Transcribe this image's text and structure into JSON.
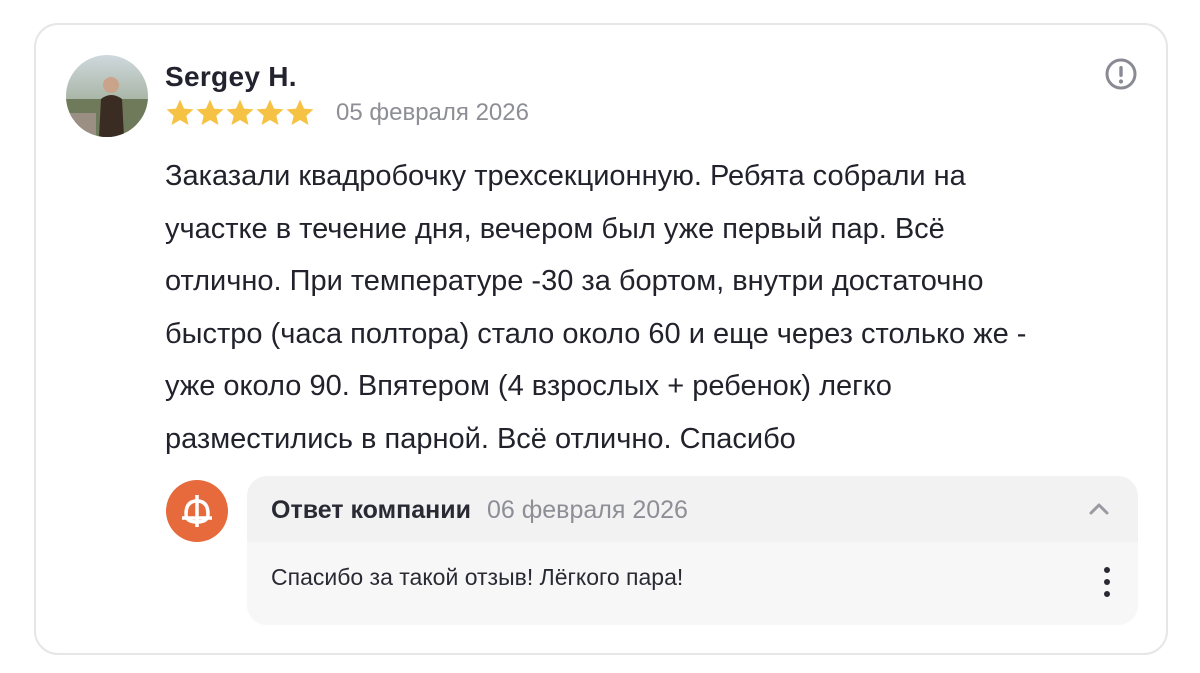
{
  "review": {
    "author": "Sergey H.",
    "rating": 5,
    "rating_max": 5,
    "date": "05 февраля 2026",
    "text_lines": [
      "Заказали квадробочку трехсекционную. Ребята собрали на",
      "участке в течение дня, вечером был уже первый пар. Всё",
      "отлично. При температуре -30 за бортом, внутри достаточно",
      "быстро (часа полтора) стало около 60 и еще через столько же -",
      "уже около 90. Впятером (4 взрослых + ребенок) легко",
      "разместились в парной. Всё отлично. Спасибо"
    ],
    "star_color": "#f6c244"
  },
  "reply": {
    "title": "Ответ компании",
    "date": "06 февраля 2026",
    "text": "Спасибо за такой отзыв! Лёгкого пара!",
    "logo_color": "#e66a3c"
  },
  "icons": {
    "report": "exclamation-circle-icon",
    "collapse": "chevron-up-icon",
    "more": "more-vertical-icon"
  }
}
